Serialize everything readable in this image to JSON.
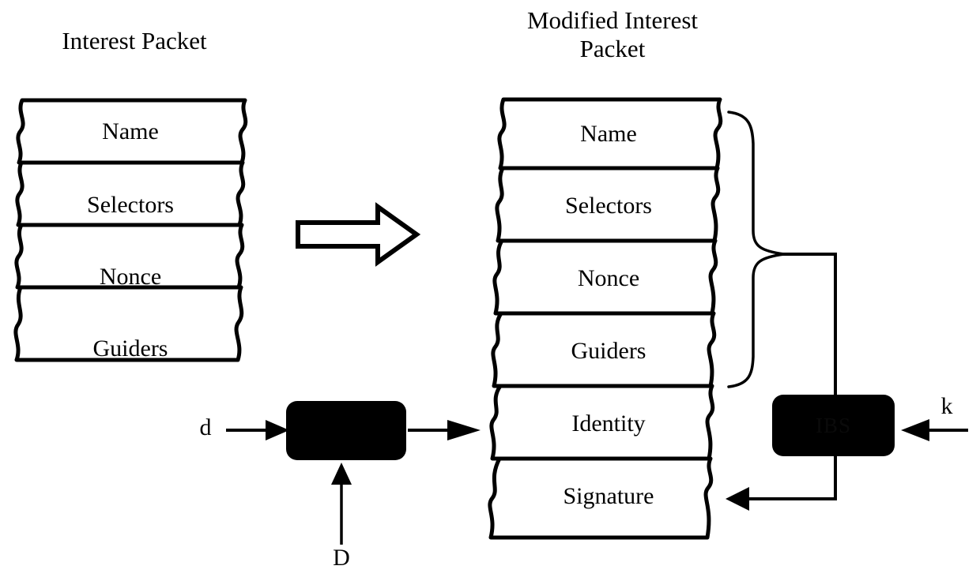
{
  "diagram": {
    "title_left": "Interest Packet",
    "title_right": "Modified Interest\nPacket",
    "left_packet": {
      "name": "interest-packet",
      "rows": [
        "Name",
        "Selectors",
        "Nonce",
        "Guiders"
      ]
    },
    "right_packet": {
      "name": "modified-interest-packet",
      "rows": [
        "Name",
        "Selectors",
        "Nonce",
        "Guiders",
        "Identity",
        "Signature"
      ]
    },
    "labels": {
      "input_d": "d",
      "input_D": "D",
      "input_k": "k"
    },
    "boxes": {
      "left_box_label": "",
      "right_box_label": "IBS"
    },
    "colors": {
      "stroke": "#000000",
      "fill": "#ffffff",
      "box_fill": "#000000",
      "box_text": "#0a0a0a"
    },
    "icons": {
      "transform_arrow": "block-arrow-right",
      "feed_arrow": "arrow-right",
      "key_arrow": "arrow-left",
      "secret_arrow": "arrow-up",
      "brace": "curly-brace-right"
    }
  }
}
